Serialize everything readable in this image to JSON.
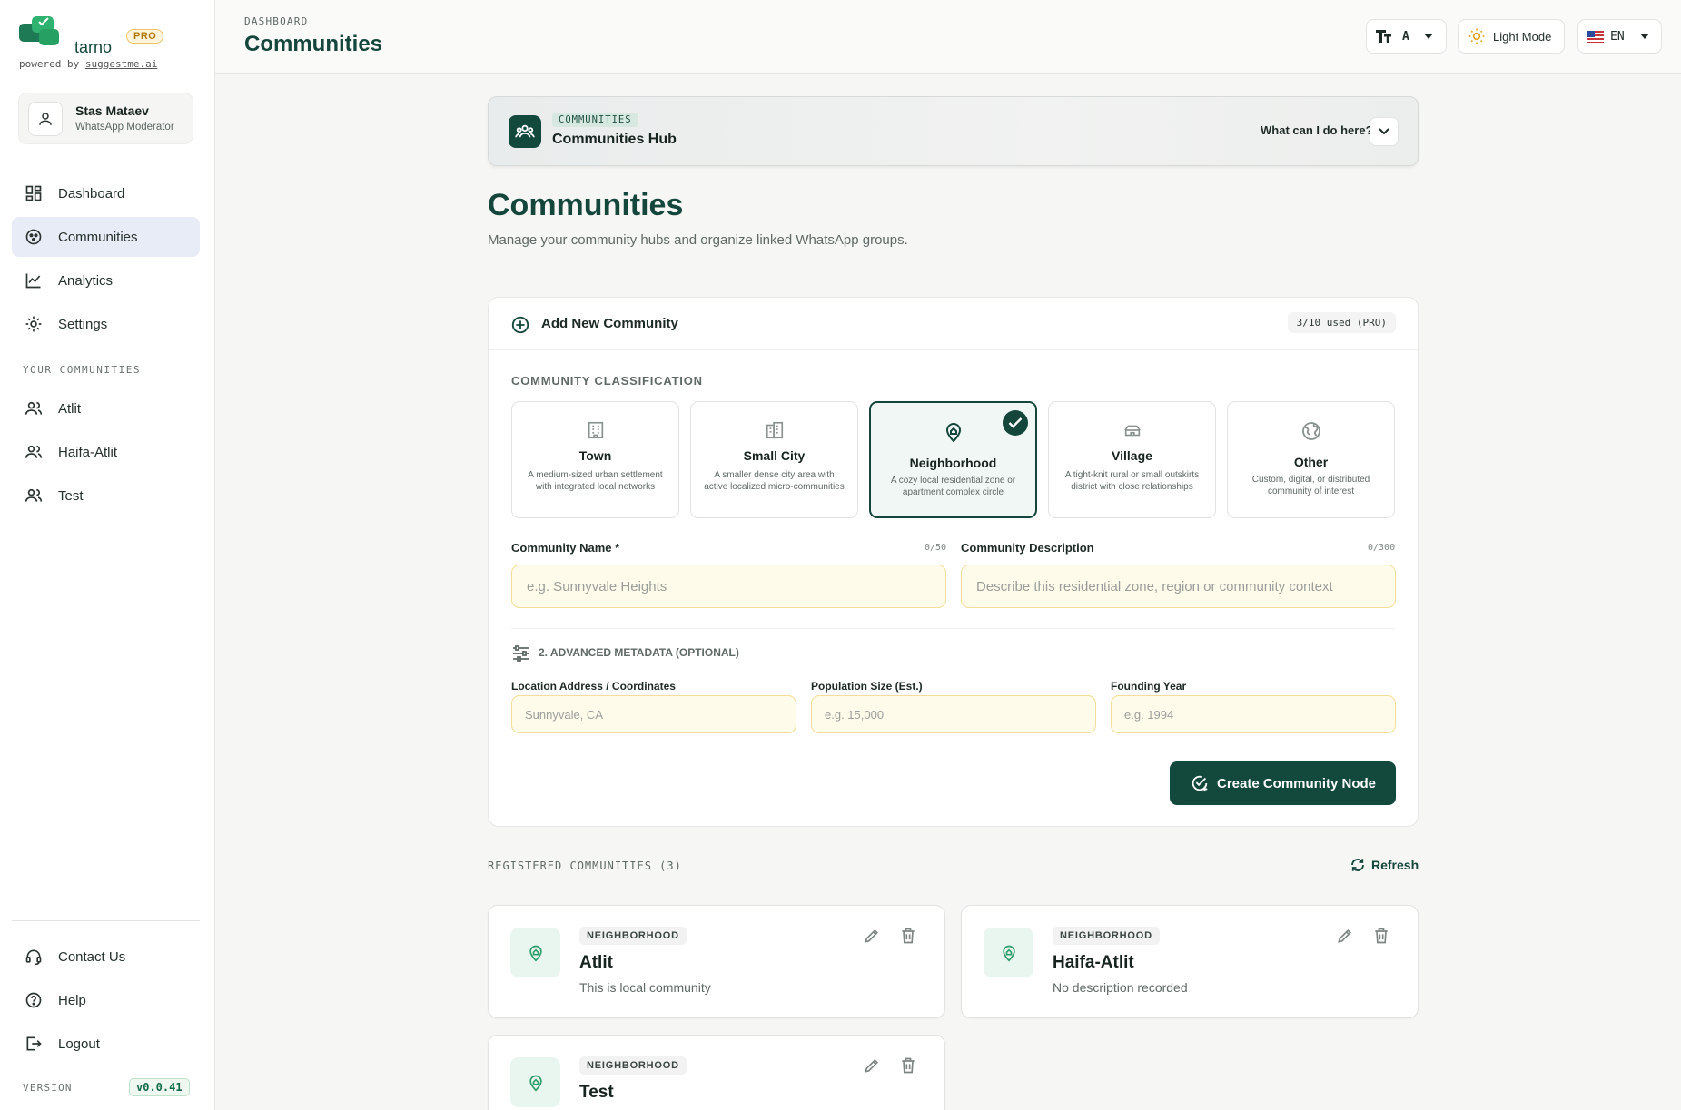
{
  "brand": {
    "name": "tarno",
    "pro": "PRO",
    "powered_prefix": "powered by",
    "powered_link": "suggestme.ai"
  },
  "user": {
    "name": "Stas Mataev",
    "role": "WhatsApp Moderator"
  },
  "nav": [
    {
      "label": "Dashboard",
      "icon": "dashboard-icon"
    },
    {
      "label": "Communities",
      "icon": "communities-icon",
      "active": true
    },
    {
      "label": "Analytics",
      "icon": "analytics-icon"
    },
    {
      "label": "Settings",
      "icon": "gear-icon"
    }
  ],
  "your_communities": {
    "label": "YOUR COMMUNITIES",
    "items": [
      "Atlit",
      "Haifa-Atlit",
      "Test"
    ]
  },
  "footer_nav": [
    {
      "label": "Contact Us",
      "icon": "headset-icon"
    },
    {
      "label": "Help",
      "icon": "help-icon"
    },
    {
      "label": "Logout",
      "icon": "logout-icon"
    }
  ],
  "version": {
    "label": "VERSION",
    "value": "v0.0.41"
  },
  "topbar": {
    "breadcrumb": "DASHBOARD",
    "title": "Communities",
    "font_size": "A",
    "theme": "Light Mode",
    "lang": "EN"
  },
  "hub": {
    "tag": "COMMUNITIES",
    "title": "Communities Hub",
    "help": "What can I do here?"
  },
  "page": {
    "title": "Communities",
    "subtitle": "Manage your community hubs and organize linked WhatsApp groups."
  },
  "add_card": {
    "title": "Add New Community",
    "usage": "3/10 used (PRO)",
    "classification_label": "COMMUNITY CLASSIFICATION",
    "options": [
      {
        "title": "Town",
        "desc": "A medium-sized urban settlement with integrated local networks",
        "icon": "town-icon"
      },
      {
        "title": "Small City",
        "desc": "A smaller dense city area with active localized micro-communities",
        "icon": "city-icon"
      },
      {
        "title": "Neighborhood",
        "desc": "A cozy local residential zone or apartment complex circle",
        "icon": "home-pin-icon",
        "selected": true
      },
      {
        "title": "Village",
        "desc": "A tight-knit rural or small outskirts district with close relationships",
        "icon": "village-icon"
      },
      {
        "title": "Other",
        "desc": "Custom, digital, or distributed community of interest",
        "icon": "globe-icon"
      }
    ],
    "name_field": {
      "label": "Community Name *",
      "count": "0/50",
      "placeholder": "e.g. Sunnyvale Heights",
      "value": ""
    },
    "desc_field": {
      "label": "Community Description",
      "count": "0/300",
      "placeholder": "Describe this residential zone, region or community context",
      "value": ""
    },
    "advanced_label": "2. ADVANCED METADATA (OPTIONAL)",
    "location_field": {
      "label": "Location Address / Coordinates",
      "placeholder": "Sunnyvale, CA"
    },
    "population_field": {
      "label": "Population Size (Est.)",
      "placeholder": "e.g. 15,000"
    },
    "year_field": {
      "label": "Founding Year",
      "placeholder": "e.g. 1994"
    },
    "submit": "Create Community Node"
  },
  "registered": {
    "label": "REGISTERED COMMUNITIES (3)",
    "refresh": "Refresh",
    "items": [
      {
        "tag": "NEIGHBORHOOD",
        "name": "Atlit",
        "desc": "This is local community"
      },
      {
        "tag": "NEIGHBORHOOD",
        "name": "Haifa-Atlit",
        "desc": "No description recorded"
      },
      {
        "tag": "NEIGHBORHOOD",
        "name": "Test",
        "desc": ""
      }
    ]
  },
  "colors": {
    "brand": "#14463b",
    "accent_green": "#2e9e6a",
    "pro": "#b07a00",
    "input_bg": "#fffbea"
  }
}
